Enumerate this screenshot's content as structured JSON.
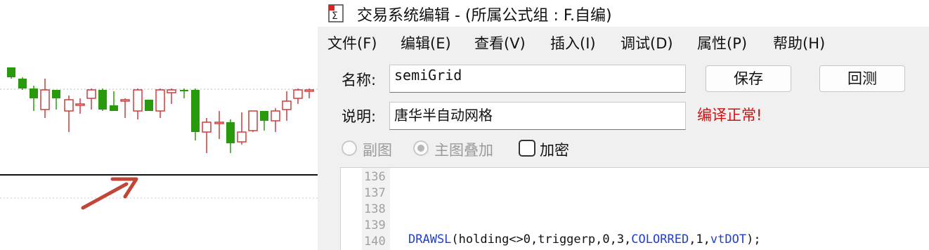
{
  "window": {
    "title": "交易系统编辑 - (所属公式组 : F.自编)",
    "icon": "formula-editor-icon"
  },
  "menu": [
    "文件(F)",
    "编辑(E)",
    "查看(V)",
    "插入(I)",
    "调试(D)",
    "属性(P)",
    "帮助(H)"
  ],
  "form": {
    "name_label": "名称:",
    "name_value": "semiGrid",
    "desc_label": "说明:",
    "desc_value": "唐华半自动网格",
    "save_button": "保存",
    "backtest_button": "回测",
    "status": "编译正常!",
    "status_color": "#cc1111",
    "radio_sub_chart": "副图",
    "radio_main_overlay": "主图叠加",
    "radio_selected": "主图叠加",
    "checkbox_encrypt": "加密",
    "checkbox_encrypt_checked": false
  },
  "editor": {
    "line_numbers": [
      "136",
      "137",
      "138",
      "139",
      "140"
    ],
    "code_140": {
      "fn": "DRAWSL",
      "open": "(holding<>0,triggerp,0,3,",
      "color": "COLORRED",
      "mid": ",1,",
      "style": "vtDOT",
      "close": ");"
    }
  },
  "chart": {
    "up_color": "#d23b3b",
    "down_color": "#2a9a0d",
    "arrow_color": "#c1463a"
  }
}
